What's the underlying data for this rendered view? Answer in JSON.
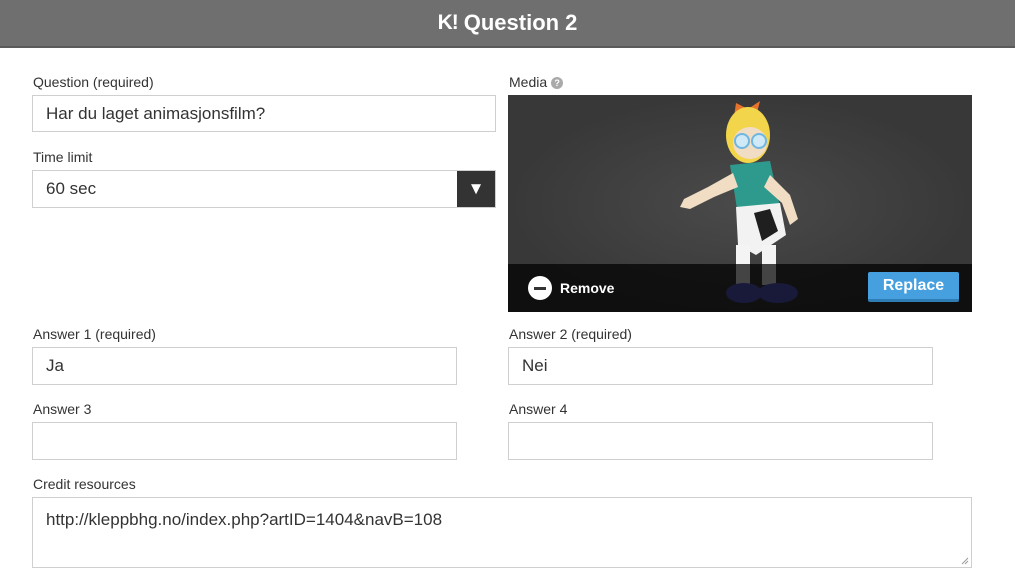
{
  "header": {
    "logo": "K!",
    "title": "Question 2"
  },
  "question": {
    "label": "Question (required)",
    "value": "Har du laget animasjonsfilm?"
  },
  "time_limit": {
    "label": "Time limit",
    "value": "60 sec",
    "arrow_glyph": "▼"
  },
  "media": {
    "label": "Media",
    "help_glyph": "?",
    "remove_label": "Remove",
    "replace_label": "Replace"
  },
  "answers": [
    {
      "label": "Answer 1 (required)",
      "value": "Ja"
    },
    {
      "label": "Answer 2 (required)",
      "value": "Nei"
    },
    {
      "label": "Answer 3",
      "value": ""
    },
    {
      "label": "Answer 4",
      "value": ""
    }
  ],
  "credit": {
    "label": "Credit resources",
    "value": "http://kleppbhg.no/index.php?artID=1404&navB=108"
  },
  "colors": {
    "header_bg": "#6f6f6f",
    "replace_button": "#46a0e0",
    "media_bg": "#383838"
  }
}
